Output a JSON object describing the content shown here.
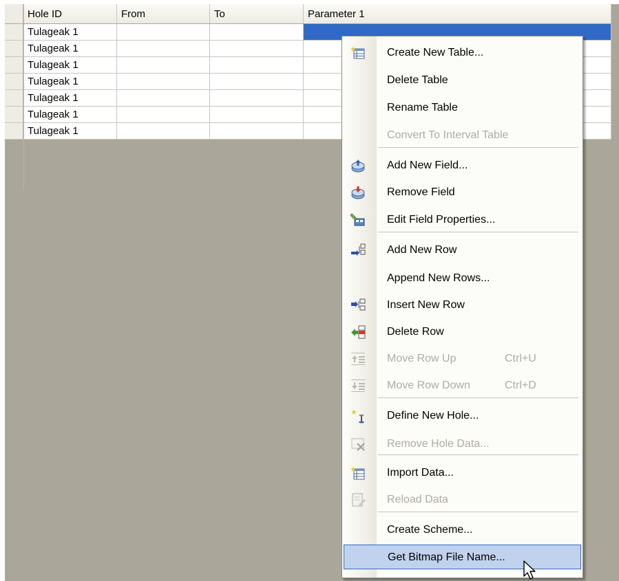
{
  "grid": {
    "columns": [
      "Hole ID",
      "From",
      "To",
      "Parameter 1"
    ],
    "rows": [
      {
        "hole_id": "Tulageak 1",
        "from": "",
        "to": "",
        "parameter_1": ""
      },
      {
        "hole_id": "Tulageak 1",
        "from": "",
        "to": "",
        "parameter_1": ""
      },
      {
        "hole_id": "Tulageak 1",
        "from": "",
        "to": "",
        "parameter_1": ""
      },
      {
        "hole_id": "Tulageak 1",
        "from": "",
        "to": "",
        "parameter_1": ""
      },
      {
        "hole_id": "Tulageak 1",
        "from": "",
        "to": "",
        "parameter_1": ""
      },
      {
        "hole_id": "Tulageak 1",
        "from": "",
        "to": "",
        "parameter_1": ""
      },
      {
        "hole_id": "Tulageak 1",
        "from": "",
        "to": "",
        "parameter_1": ""
      }
    ],
    "selected_cell": "row 1, Parameter 1"
  },
  "menu": {
    "items": [
      {
        "label": "Create New Table...",
        "icon": "new-table-icon",
        "enabled": true
      },
      {
        "label": "Delete Table",
        "icon": "",
        "enabled": true
      },
      {
        "label": "Rename Table",
        "icon": "",
        "enabled": true
      },
      {
        "label": "Convert To Interval Table",
        "icon": "",
        "enabled": false
      },
      {
        "label": "Add New Field...",
        "icon": "add-field-icon",
        "enabled": true
      },
      {
        "label": "Remove Field",
        "icon": "remove-field-icon",
        "enabled": true
      },
      {
        "label": "Edit Field Properties...",
        "icon": "edit-field-icon",
        "enabled": true
      },
      {
        "label": "Add New Row",
        "icon": "add-row-icon",
        "enabled": true
      },
      {
        "label": "Append New Rows...",
        "icon": "",
        "enabled": true
      },
      {
        "label": "Insert New Row",
        "icon": "insert-row-icon",
        "enabled": true
      },
      {
        "label": "Delete Row",
        "icon": "delete-row-icon",
        "enabled": true
      },
      {
        "label": "Move Row Up",
        "shortcut": "Ctrl+U",
        "icon": "move-row-up-icon",
        "enabled": false
      },
      {
        "label": "Move Row Down",
        "shortcut": "Ctrl+D",
        "icon": "move-row-down-icon",
        "enabled": false
      },
      {
        "label": "Define New Hole...",
        "icon": "define-hole-icon",
        "enabled": true
      },
      {
        "label": "Remove Hole Data...",
        "icon": "remove-hole-icon",
        "enabled": false
      },
      {
        "label": "Import Data...",
        "icon": "import-data-icon",
        "enabled": true
      },
      {
        "label": "Reload Data",
        "icon": "reload-data-icon",
        "enabled": false
      },
      {
        "label": "Create Scheme...",
        "icon": "",
        "enabled": true
      },
      {
        "label": "Get Bitmap File Name...",
        "icon": "",
        "enabled": true,
        "highlighted": true
      }
    ]
  },
  "colors": {
    "empty_area": "#aaa79a",
    "selection": "#3169c6",
    "menu_highlight": "#c1d2ee",
    "menu_highlight_border": "#316ac5",
    "disabled_text": "#aeaca4"
  }
}
